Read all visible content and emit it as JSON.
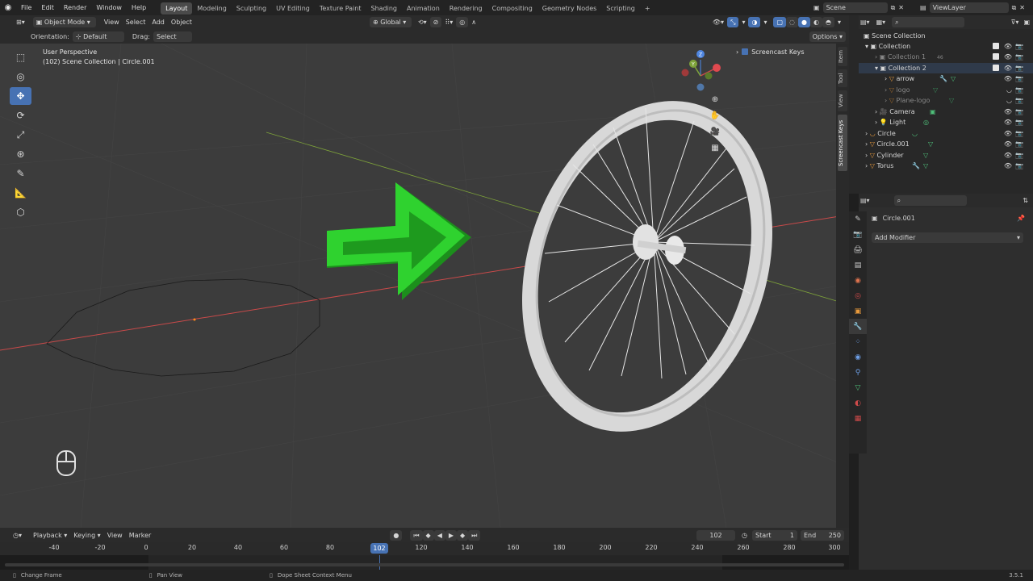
{
  "topbar": {
    "menus": [
      "File",
      "Edit",
      "Render",
      "Window",
      "Help"
    ],
    "workspaces": [
      "Layout",
      "Modeling",
      "Sculpting",
      "UV Editing",
      "Texture Paint",
      "Shading",
      "Animation",
      "Rendering",
      "Compositing",
      "Geometry Nodes",
      "Scripting"
    ],
    "active_workspace": "Layout",
    "add_tab": "+",
    "scene_name": "Scene",
    "view_layer": "ViewLayer"
  },
  "viewport_header": {
    "mode": "Object Mode",
    "menus": [
      "View",
      "Select",
      "Add",
      "Object"
    ],
    "transform": "Global"
  },
  "tool_header": {
    "orientation_label": "Orientation:",
    "orientation_value": "Default",
    "drag_label": "Drag:",
    "drag_value": "Select Box",
    "options": "Options"
  },
  "viewport": {
    "perspective": "User Perspective",
    "context": "(102) Scene Collection | Circle.001",
    "screencast_label": "Screencast Keys",
    "gizmo_z": "Z",
    "gizmo_y": "Y"
  },
  "side_tabs": [
    "Item",
    "Tool",
    "View",
    "Screencast Keys"
  ],
  "outliner": {
    "rows": [
      {
        "label": "Scene Collection"
      },
      {
        "label": "Collection"
      },
      {
        "label": "Collection 1",
        "badge": "46"
      },
      {
        "label": "Collection 2"
      },
      {
        "label": "arrow"
      },
      {
        "label": "logo"
      },
      {
        "label": "Plane-logo"
      },
      {
        "label": "Camera"
      },
      {
        "label": "Light"
      },
      {
        "label": "Circle"
      },
      {
        "label": "Circle.001"
      },
      {
        "label": "Cylinder"
      },
      {
        "label": "Torus"
      }
    ]
  },
  "properties": {
    "object_name": "Circle.001",
    "add_modifier": "Add Modifier"
  },
  "timeline": {
    "menus": [
      "Playback",
      "Keying",
      "View",
      "Marker"
    ],
    "current_frame": "102",
    "start_label": "Start",
    "start_value": "1",
    "end_label": "End",
    "end_value": "250",
    "ticks": [
      "-40",
      "-20",
      "0",
      "20",
      "40",
      "60",
      "80",
      "120",
      "140",
      "160",
      "180",
      "200",
      "220",
      "240",
      "260",
      "280",
      "300"
    ],
    "playhead": "102"
  },
  "statusbar": {
    "left": "Change Frame",
    "middle": "Pan View",
    "right": "Dope Sheet Context Menu",
    "version": "3.5.1"
  },
  "colors": {
    "accent": "#4772b3",
    "arrow_green": "#2fd22f",
    "x_axis": "#c94a4a",
    "y_axis": "#7ea33a"
  }
}
